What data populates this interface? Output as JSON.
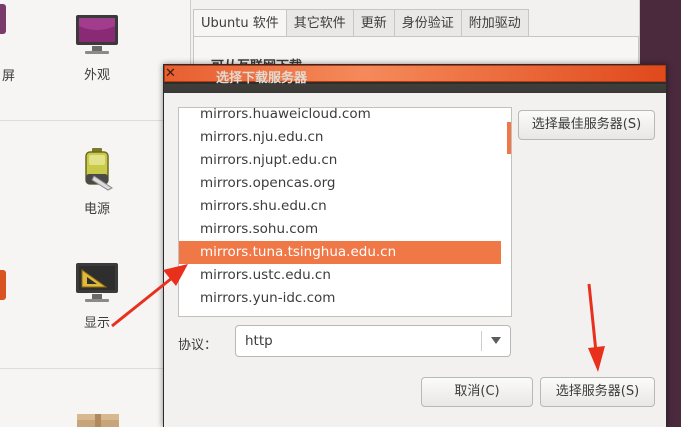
{
  "background": {
    "settings": {
      "items": [
        {
          "label": "外观",
          "icon": "appearance-icon"
        },
        {
          "label": "电源",
          "icon": "battery-icon"
        },
        {
          "label": "显示",
          "icon": "display-icon"
        }
      ],
      "cut_label": "屏"
    },
    "software_window": {
      "tabs": [
        "Ubuntu 软件",
        "其它软件",
        "更新",
        "身份验证",
        "附加驱动"
      ],
      "section_title": "可从互联网下载"
    }
  },
  "dialog": {
    "title": "选择下载服务器",
    "servers": [
      "mirrors.huaweicloud.com",
      "mirrors.nju.edu.cn",
      "mirrors.njupt.edu.cn",
      "mirrors.opencas.org",
      "mirrors.shu.edu.cn",
      "mirrors.sohu.com",
      "mirrors.tuna.tsinghua.edu.cn",
      "mirrors.ustc.edu.cn",
      "mirrors.yun-idc.com"
    ],
    "selected_server": "mirrors.tuna.tsinghua.edu.cn",
    "best_server_button": "选择最佳服务器(S)",
    "protocol_label": "协议：",
    "protocol_value": "http",
    "cancel_button": "取消(C)",
    "choose_button": "选择服务器(S)"
  },
  "colors": {
    "accent": "#f07746",
    "annotation_arrow": "#e8301c",
    "titlebar": "#3c3b37",
    "close_button": "#e95420"
  }
}
